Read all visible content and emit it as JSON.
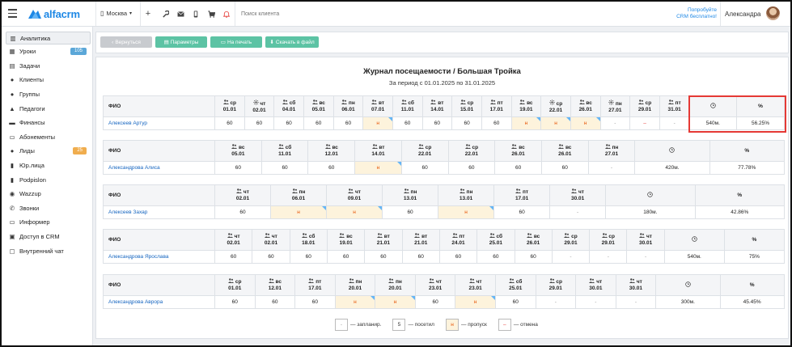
{
  "header": {
    "logo_text": "alfacrm",
    "branch": "Москва",
    "search_placeholder": "Поиск клиента",
    "promo_line1": "Попробуйте",
    "promo_line2": "CRM бесплатно!",
    "user_name": "Александра",
    "icons": [
      "plus-icon",
      "wrench-icon",
      "envelope-icon",
      "phone-icon",
      "cart-icon",
      "bell-icon"
    ]
  },
  "sidebar": {
    "items": [
      {
        "label": "Аналитика",
        "icon": "chart-icon",
        "glyph": "▥",
        "active": true
      },
      {
        "label": "Уроки",
        "icon": "calendar-icon",
        "glyph": "▦",
        "badge": "105",
        "badge_color": "#5ba7d8"
      },
      {
        "label": "Задачи",
        "icon": "tasks-icon",
        "glyph": "▤"
      },
      {
        "label": "Клиенты",
        "icon": "user-icon",
        "glyph": "●"
      },
      {
        "label": "Группы",
        "icon": "group-icon",
        "glyph": "●"
      },
      {
        "label": "Педагоги",
        "icon": "graduation-cap-icon",
        "glyph": "▲"
      },
      {
        "label": "Финансы",
        "icon": "money-icon",
        "glyph": "▬"
      },
      {
        "label": "Абонементы",
        "icon": "ticket-icon",
        "glyph": "▭"
      },
      {
        "label": "Лиды",
        "icon": "add-user-icon",
        "glyph": "●",
        "badge": "25",
        "badge_color": "#f0ad4e"
      },
      {
        "label": "Юр.лица",
        "icon": "building-icon",
        "glyph": "▮"
      },
      {
        "label": "Podpislon",
        "icon": "document-icon",
        "glyph": "▮"
      },
      {
        "label": "Wazzup",
        "icon": "whatsapp-icon",
        "glyph": "◉"
      },
      {
        "label": "Звонки",
        "icon": "phone-icon",
        "glyph": "✆"
      },
      {
        "label": "Информер",
        "icon": "informer-icon",
        "glyph": "▭"
      },
      {
        "label": "Доступ в CRM",
        "icon": "lock-icon",
        "glyph": "▣"
      },
      {
        "label": "Внутренний чат",
        "icon": "chat-icon",
        "glyph": "▢"
      }
    ]
  },
  "toolbar": {
    "back_label": "Вернуться",
    "params_label": "Параметры",
    "print_label": "На печать",
    "download_label": "Скачать в файл",
    "colors": {
      "back": "#c8cbcf",
      "action": "#5cc3a4"
    }
  },
  "report": {
    "title": "Журнал посещаемости / Большая Тройка",
    "period": "За период с 01.01.2025 по 31.01.2025",
    "fio_header": "ФИО",
    "percent_header": "%",
    "tables": [
      {
        "student": "Алексеев Артур",
        "minutes": "540м.",
        "percent": "56.25%",
        "lessons": [
          {
            "day": "ср",
            "date": "01.01",
            "value": "60",
            "status": "attended",
            "icon": "group"
          },
          {
            "day": "чт",
            "date": "02.01",
            "value": "60",
            "status": "attended",
            "icon": "sun"
          },
          {
            "day": "сб",
            "date": "04.01",
            "value": "60",
            "status": "attended",
            "icon": "group"
          },
          {
            "day": "вс",
            "date": "05.01",
            "value": "60",
            "status": "attended",
            "icon": "group"
          },
          {
            "day": "пн",
            "date": "06.01",
            "value": "60",
            "status": "attended",
            "icon": "group"
          },
          {
            "day": "вт",
            "date": "07.01",
            "value": "н",
            "status": "miss",
            "icon": "group"
          },
          {
            "day": "сб",
            "date": "11.01",
            "value": "60",
            "status": "attended",
            "icon": "group"
          },
          {
            "day": "вт",
            "date": "14.01",
            "value": "60",
            "status": "attended",
            "icon": "group"
          },
          {
            "day": "ср",
            "date": "15.01",
            "value": "60",
            "status": "attended",
            "icon": "group"
          },
          {
            "day": "пт",
            "date": "17.01",
            "value": "60",
            "status": "attended",
            "icon": "group"
          },
          {
            "day": "вс",
            "date": "19.01",
            "value": "н",
            "status": "miss",
            "icon": "group"
          },
          {
            "day": "ср",
            "date": "22.01",
            "value": "н",
            "status": "miss",
            "icon": "sun"
          },
          {
            "day": "вс",
            "date": "26.01",
            "value": "н",
            "status": "miss",
            "icon": "group"
          },
          {
            "day": "пн",
            "date": "27.01",
            "value": "-",
            "status": "plan",
            "icon": "sun"
          },
          {
            "day": "ср",
            "date": "29.01",
            "value": "–",
            "status": "cancel",
            "icon": "group"
          },
          {
            "day": "пт",
            "date": "31.01",
            "value": "-",
            "status": "plan",
            "icon": "group"
          }
        ]
      },
      {
        "student": "Александрова Алиса",
        "minutes": "420м.",
        "percent": "77.78%",
        "lessons": [
          {
            "day": "вс",
            "date": "05.01",
            "value": "60",
            "status": "attended",
            "icon": "group"
          },
          {
            "day": "сб",
            "date": "11.01",
            "value": "60",
            "status": "attended",
            "icon": "group"
          },
          {
            "day": "вс",
            "date": "12.01",
            "value": "60",
            "status": "attended",
            "icon": "group"
          },
          {
            "day": "вт",
            "date": "14.01",
            "value": "н",
            "status": "miss",
            "icon": "group"
          },
          {
            "day": "ср",
            "date": "22.01",
            "value": "60",
            "status": "attended",
            "icon": "group"
          },
          {
            "day": "ср",
            "date": "22.01",
            "value": "60",
            "status": "attended",
            "icon": "group"
          },
          {
            "day": "вс",
            "date": "26.01",
            "value": "60",
            "status": "attended",
            "icon": "group"
          },
          {
            "day": "вс",
            "date": "26.01",
            "value": "60",
            "status": "attended",
            "icon": "group"
          },
          {
            "day": "пн",
            "date": "27.01",
            "value": "-",
            "status": "plan",
            "icon": "group"
          }
        ]
      },
      {
        "student": "Алексеев Захар",
        "minutes": "180м.",
        "percent": "42.86%",
        "lessons": [
          {
            "day": "чт",
            "date": "02.01",
            "value": "60",
            "status": "attended",
            "icon": "group"
          },
          {
            "day": "пн",
            "date": "06.01",
            "value": "н",
            "status": "miss",
            "icon": "group"
          },
          {
            "day": "чт",
            "date": "09.01",
            "value": "н",
            "status": "miss",
            "icon": "group"
          },
          {
            "day": "пн",
            "date": "13.01",
            "value": "60",
            "status": "attended",
            "icon": "group"
          },
          {
            "day": "пн",
            "date": "13.01",
            "value": "н",
            "status": "miss",
            "icon": "group"
          },
          {
            "day": "пт",
            "date": "17.01",
            "value": "60",
            "status": "attended",
            "icon": "group"
          },
          {
            "day": "чт",
            "date": "30.01",
            "value": "-",
            "status": "plan",
            "icon": "group"
          }
        ]
      },
      {
        "student": "Александрова Ярослава",
        "minutes": "540м.",
        "percent": "75%",
        "lessons": [
          {
            "day": "чт",
            "date": "02.01",
            "value": "60",
            "status": "attended",
            "icon": "group"
          },
          {
            "day": "чт",
            "date": "02.01",
            "value": "60",
            "status": "attended",
            "icon": "group"
          },
          {
            "day": "сб",
            "date": "18.01",
            "value": "60",
            "status": "attended",
            "icon": "group"
          },
          {
            "day": "вс",
            "date": "19.01",
            "value": "60",
            "status": "attended",
            "icon": "group"
          },
          {
            "day": "вт",
            "date": "21.01",
            "value": "60",
            "status": "attended",
            "icon": "group"
          },
          {
            "day": "вт",
            "date": "21.01",
            "value": "60",
            "status": "attended",
            "icon": "group"
          },
          {
            "day": "пт",
            "date": "24.01",
            "value": "60",
            "status": "attended",
            "icon": "group"
          },
          {
            "day": "сб",
            "date": "25.01",
            "value": "60",
            "status": "attended",
            "icon": "group"
          },
          {
            "day": "вс",
            "date": "26.01",
            "value": "60",
            "status": "attended",
            "icon": "group"
          },
          {
            "day": "ср",
            "date": "29.01",
            "value": "-",
            "status": "plan",
            "icon": "group"
          },
          {
            "day": "ср",
            "date": "29.01",
            "value": "-",
            "status": "plan",
            "icon": "group"
          },
          {
            "day": "чт",
            "date": "30.01",
            "value": "-",
            "status": "plan",
            "icon": "group"
          }
        ]
      },
      {
        "student": "Александрова Аврора",
        "minutes": "300м.",
        "percent": "45.45%",
        "lessons": [
          {
            "day": "ср",
            "date": "01.01",
            "value": "60",
            "status": "attended",
            "icon": "group"
          },
          {
            "day": "вс",
            "date": "12.01",
            "value": "60",
            "status": "attended",
            "icon": "group"
          },
          {
            "day": "пт",
            "date": "17.01",
            "value": "60",
            "status": "attended",
            "icon": "group"
          },
          {
            "day": "пн",
            "date": "20.01",
            "value": "н",
            "status": "miss",
            "icon": "group"
          },
          {
            "day": "пн",
            "date": "20.01",
            "value": "н",
            "status": "miss",
            "icon": "group"
          },
          {
            "day": "чт",
            "date": "23.01",
            "value": "60",
            "status": "attended",
            "icon": "group"
          },
          {
            "day": "чт",
            "date": "23.01",
            "value": "н",
            "status": "miss",
            "icon": "group"
          },
          {
            "day": "сб",
            "date": "25.01",
            "value": "60",
            "status": "attended",
            "icon": "group"
          },
          {
            "day": "ср",
            "date": "29.01",
            "value": "-",
            "status": "plan",
            "icon": "group"
          },
          {
            "day": "чт",
            "date": "30.01",
            "value": "-",
            "status": "plan",
            "icon": "group"
          },
          {
            "day": "чт",
            "date": "30.01",
            "value": "-",
            "status": "plan",
            "icon": "group"
          }
        ]
      }
    ]
  },
  "legend": {
    "planned_symbol": "-",
    "planned_label": "— запланир.",
    "attended_symbol": "5",
    "attended_label": "— посетил",
    "miss_symbol": "н",
    "miss_label": "— пропуск",
    "cancel_symbol": "–",
    "cancel_label": "— отмена"
  }
}
